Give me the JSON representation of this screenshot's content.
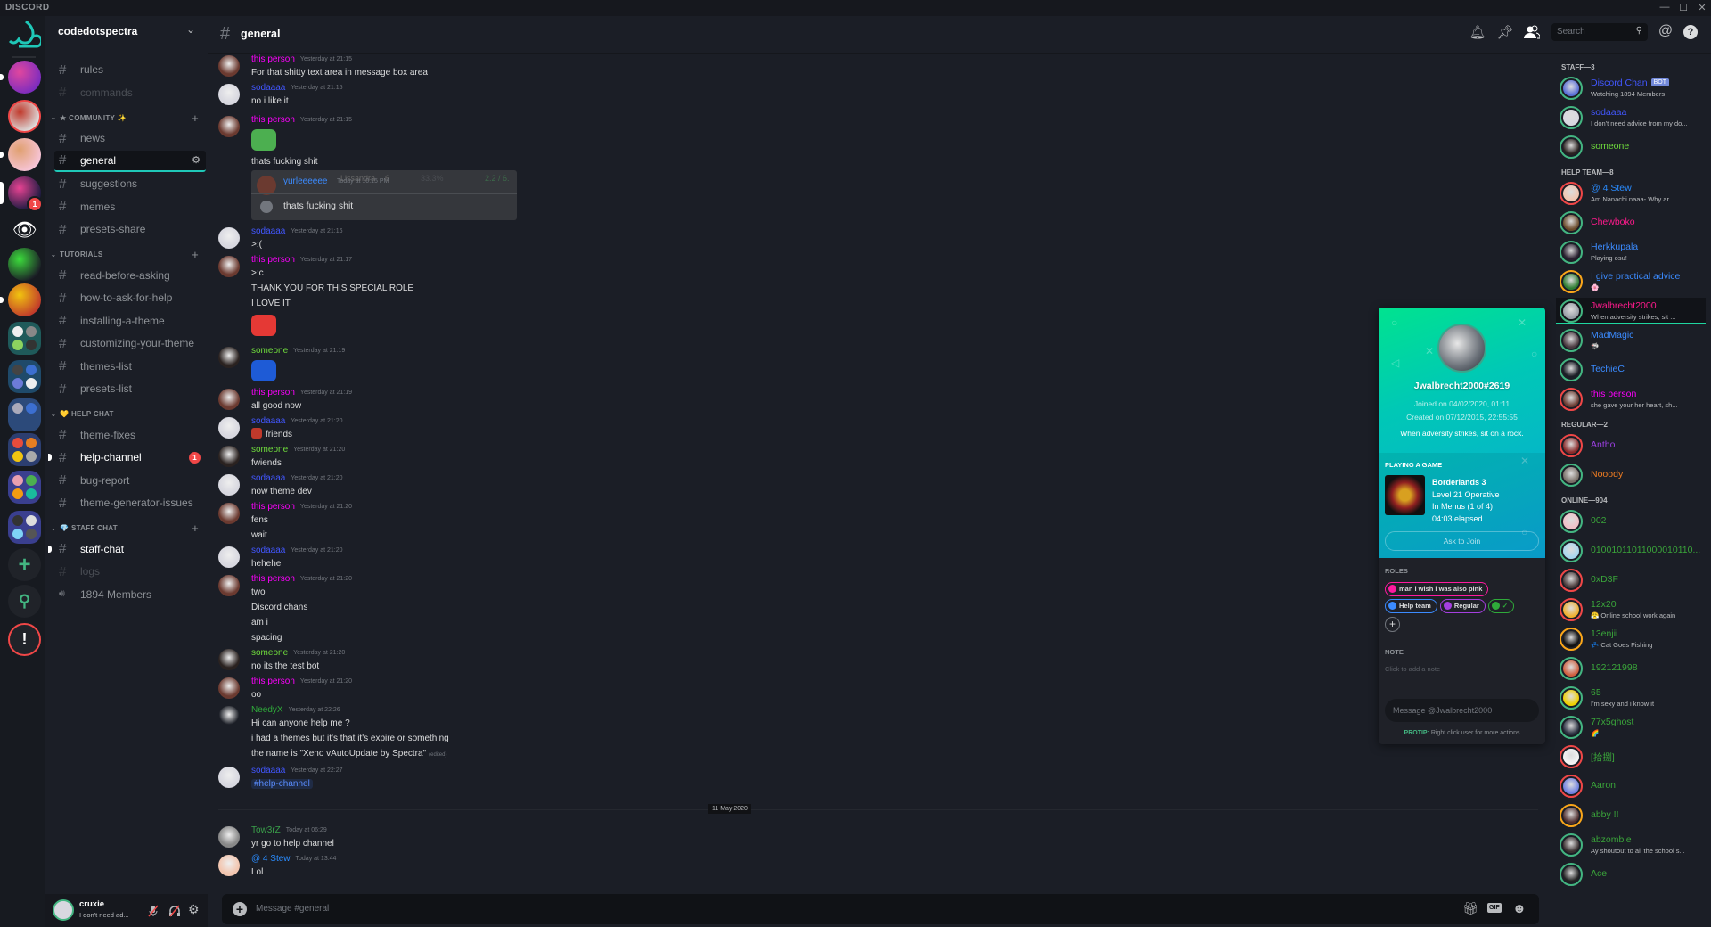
{
  "window": {
    "brand": "DISCORD",
    "min": "—",
    "max": "☐",
    "close": "✕"
  },
  "colors": {
    "accent": "#1fc8b8",
    "online": "#43b581",
    "idle": "#faa61a",
    "dnd": "#f04747"
  },
  "servers": [
    {
      "type": "logo",
      "icon": "spectra-logo-icon"
    },
    {
      "type": "icon",
      "colors": [
        "#7b2cbf",
        "#e0479e"
      ],
      "pill": "dot"
    },
    {
      "type": "icon",
      "colors": [
        "#ddd",
        "#c0392b"
      ],
      "ring": "#f04747"
    },
    {
      "type": "icon",
      "colors": [
        "#f7c5d8",
        "#e0a070"
      ],
      "pill": "dot"
    },
    {
      "type": "icon",
      "colors": [
        "#1a1a40",
        "#e84393"
      ],
      "pill": "active",
      "badge": "1"
    },
    {
      "type": "eye",
      "icon": "eye-icon"
    },
    {
      "type": "icon",
      "colors": [
        "#1b1e26",
        "#3cdc3c"
      ]
    },
    {
      "type": "icon",
      "colors": [
        "#c0392b",
        "#f1c40f"
      ],
      "pill": "dot"
    },
    {
      "type": "folder",
      "bg": "#1f5a5a",
      "dots": [
        "#eee",
        "#888",
        "#8dd35f",
        "#333"
      ]
    },
    {
      "type": "folder",
      "bg": "#1f4a6a",
      "dots": [
        "#444",
        "#3c6fd0",
        "#6c7bd8",
        "#eee"
      ]
    },
    {
      "type": "folder",
      "bg": "#2c4a7a",
      "dots": [
        "#aab",
        "#3c6fd0",
        "#2c4a7a",
        "#2c4a7a"
      ]
    },
    {
      "type": "folder",
      "bg": "#2c3e70",
      "dots": [
        "#e74c3c",
        "#e67e22",
        "#f1c40f",
        "#aaa"
      ]
    },
    {
      "type": "folder",
      "bg": "#3a3f8f",
      "dots": [
        "#e9a0b0",
        "#4caf50",
        "#f39c12",
        "#1abc9c"
      ]
    },
    {
      "type": "folder",
      "bg": "#3a3f8f",
      "dots": [
        "#333",
        "#ddd",
        "#7fd3f7",
        "#555"
      ]
    },
    {
      "type": "add",
      "icon": "plus-icon",
      "glyph": "+"
    },
    {
      "type": "search",
      "icon": "search-icon",
      "glyph": "⚲"
    },
    {
      "type": "alert",
      "icon": "alert-icon",
      "glyph": "!"
    }
  ],
  "guild": {
    "name": "codedotspectra",
    "chevron": "⌄"
  },
  "channels": [
    {
      "kind": "ch",
      "name": "rules"
    },
    {
      "kind": "ch",
      "name": "commands",
      "state": "muted"
    },
    {
      "kind": "cat",
      "name": "★ COMMUNITY ✨",
      "plus": "+"
    },
    {
      "kind": "ch",
      "name": "news"
    },
    {
      "kind": "ch",
      "name": "general",
      "state": "sel",
      "gear": "⚙"
    },
    {
      "kind": "ch",
      "name": "suggestions"
    },
    {
      "kind": "ch",
      "name": "memes"
    },
    {
      "kind": "ch",
      "name": "presets-share"
    },
    {
      "kind": "cat",
      "name": "TUTORIALS",
      "plus": "+"
    },
    {
      "kind": "ch",
      "name": "read-before-asking"
    },
    {
      "kind": "ch",
      "name": "how-to-ask-for-help"
    },
    {
      "kind": "ch",
      "name": "installing-a-theme"
    },
    {
      "kind": "ch",
      "name": "customizing-your-theme"
    },
    {
      "kind": "ch",
      "name": "themes-list"
    },
    {
      "kind": "ch",
      "name": "presets-list"
    },
    {
      "kind": "cat",
      "name": "💛 HELP CHAT"
    },
    {
      "kind": "ch",
      "name": "theme-fixes"
    },
    {
      "kind": "ch",
      "name": "help-channel",
      "state": "unread",
      "badge": "1"
    },
    {
      "kind": "ch",
      "name": "bug-report"
    },
    {
      "kind": "ch",
      "name": "theme-generator-issues"
    },
    {
      "kind": "cat",
      "name": "💎 STAFF CHAT",
      "plus": "+"
    },
    {
      "kind": "ch",
      "name": "staff-chat",
      "state": "unread"
    },
    {
      "kind": "ch",
      "name": "logs",
      "state": "muted"
    },
    {
      "kind": "voice",
      "name": "1894 Members"
    }
  ],
  "user": {
    "name": "cruxie",
    "status": "I don't need ad...",
    "mute_icon": "microphone-muted-icon",
    "deafen_icon": "headphones-muted-icon",
    "settings_icon": "gear-icon"
  },
  "header": {
    "channel": "general",
    "search_placeholder": "Search"
  },
  "messages": [
    {
      "author": "this person",
      "color": "#ff00ff",
      "avatar": "#6b3a30",
      "time": "Yesterday at 21:15",
      "lines": [
        {
          "t": "text",
          "v": "For that shitty text area in message box area"
        }
      ]
    },
    {
      "author": "sodaaaa",
      "color": "#4257ff",
      "avatar": "#d8d8e0",
      "time": "Yesterday at 21:15",
      "lines": [
        {
          "t": "text",
          "v": "no i like it"
        }
      ]
    },
    {
      "author": "this person",
      "color": "#ff00ff",
      "avatar": "#6b3a30",
      "time": "Yesterday at 21:15",
      "lines": [
        {
          "t": "emoji",
          "name": "pepe-emoji",
          "c": "#4caf50"
        },
        {
          "t": "text",
          "v": "thats fucking shit"
        },
        {
          "t": "embed",
          "author": "yurleeeeee",
          "time": "Today at 10:15 PM",
          "text": "thats fucking shit",
          "bg1": "Lissandra",
          "bg2": "6",
          "bg3": "33.3%",
          "bg4": "2.2 / 6."
        }
      ]
    },
    {
      "author": "sodaaaa",
      "color": "#4257ff",
      "avatar": "#d8d8e0",
      "time": "Yesterday at 21:16",
      "lines": [
        {
          "t": "text",
          "v": ">:("
        }
      ]
    },
    {
      "author": "this person",
      "color": "#ff00ff",
      "avatar": "#6b3a30",
      "time": "Yesterday at 21:17",
      "lines": [
        {
          "t": "text",
          "v": ">:c"
        },
        {
          "t": "text",
          "v": "THANK YOU FOR THIS SPECIAL ROLE"
        },
        {
          "t": "text",
          "v": "I LOVE IT"
        },
        {
          "t": "emoji",
          "name": "heart-emoji",
          "c": "#e53935"
        }
      ]
    },
    {
      "author": "someone",
      "color": "#6fdc3c",
      "avatar": "#2a2220",
      "time": "Yesterday at 21:19",
      "lines": [
        {
          "t": "emoji",
          "name": "blue-blob-emoji",
          "c": "#1e5bd6"
        }
      ]
    },
    {
      "author": "this person",
      "color": "#ff00ff",
      "avatar": "#6b3a30",
      "time": "Yesterday at 21:19",
      "lines": [
        {
          "t": "text",
          "v": "all good now"
        }
      ]
    },
    {
      "author": "sodaaaa",
      "color": "#4257ff",
      "avatar": "#d8d8e0",
      "time": "Yesterday at 21:20",
      "lines": [
        {
          "t": "text",
          "v": "friends",
          "emoji": true
        }
      ]
    },
    {
      "author": "someone",
      "color": "#6fdc3c",
      "avatar": "#2a2220",
      "time": "Yesterday at 21:20",
      "lines": [
        {
          "t": "text",
          "v": "fwiends"
        }
      ]
    },
    {
      "author": "sodaaaa",
      "color": "#4257ff",
      "avatar": "#d8d8e0",
      "time": "Yesterday at 21:20",
      "lines": [
        {
          "t": "text",
          "v": "now theme dev"
        }
      ]
    },
    {
      "author": "this person",
      "color": "#ff00ff",
      "avatar": "#6b3a30",
      "time": "Yesterday at 21:20",
      "lines": [
        {
          "t": "text",
          "v": "fens"
        },
        {
          "t": "text",
          "v": "wait"
        }
      ]
    },
    {
      "author": "sodaaaa",
      "color": "#4257ff",
      "avatar": "#d8d8e0",
      "time": "Yesterday at 21:20",
      "lines": [
        {
          "t": "text",
          "v": "hehehe"
        }
      ]
    },
    {
      "author": "this person",
      "color": "#ff00ff",
      "avatar": "#6b3a30",
      "time": "Yesterday at 21:20",
      "lines": [
        {
          "t": "text",
          "v": "two"
        },
        {
          "t": "text",
          "v": "Discord chans"
        },
        {
          "t": "text",
          "v": "am i"
        },
        {
          "t": "text",
          "v": "spacing"
        }
      ]
    },
    {
      "author": "someone",
      "color": "#6fdc3c",
      "avatar": "#2a2220",
      "time": "Yesterday at 21:20",
      "lines": [
        {
          "t": "text",
          "v": "no its the test bot"
        }
      ]
    },
    {
      "author": "this person",
      "color": "#ff00ff",
      "avatar": "#6b3a30",
      "time": "Yesterday at 21:20",
      "lines": [
        {
          "t": "text",
          "v": "oo"
        }
      ]
    },
    {
      "author": "NeedyX",
      "color": "#2faa3a",
      "avatar": "#1b1e26",
      "time": "Yesterday at 22:26",
      "lines": [
        {
          "t": "text",
          "v": "Hi can anyone help me ?"
        },
        {
          "t": "text",
          "v": "i had a themes but it's that it's expire or something"
        },
        {
          "t": "text",
          "v": "the name is \"Xeno vAutoUpdate by Spectra\"",
          "edited": "(edited)"
        }
      ]
    },
    {
      "author": "sodaaaa",
      "color": "#4257ff",
      "avatar": "#d8d8e0",
      "time": "Yesterday at 22:27",
      "lines": [
        {
          "t": "mention",
          "v": "#help-channel"
        }
      ]
    },
    {
      "divider": "11 May 2020"
    },
    {
      "author": "Tow3rZ",
      "color": "#3aa04a",
      "avatar": "#888",
      "time": "Today at 06:29",
      "lines": [
        {
          "t": "text",
          "v": "yr go to help channel"
        }
      ]
    },
    {
      "author": "@ 4 Stew",
      "color": "#2a8cff",
      "avatar": "#f2c6b0",
      "time": "Today at 13:44",
      "lines": [
        {
          "t": "text",
          "v": "Lol"
        }
      ]
    }
  ],
  "composer": {
    "placeholder": "Message #general",
    "icons": [
      "gift-icon",
      "gif-icon",
      "emoji-icon"
    ],
    "gif": "GIF"
  },
  "members": [
    {
      "section": "STAFF—3"
    },
    {
      "name": "Discord Chan",
      "color": "#4257ff",
      "bot": "BOT",
      "activity": "Watching 1894 Members",
      "status": "online",
      "av": "#5a6fd8"
    },
    {
      "name": "sodaaaa",
      "color": "#4257ff",
      "activity": "I don't need advice from my do...",
      "status": "online",
      "av": "#d8d8e0"
    },
    {
      "name": "someone",
      "color": "#6fdc3c",
      "status": "online",
      "av": "#2a2220"
    },
    {
      "section": "HELP TEAM—8"
    },
    {
      "name": "@ 4 Stew",
      "color": "#2a8cff",
      "activity": "Am Nanachi naaa- Why ar...",
      "status": "dnd",
      "av": "#f2c6b0"
    },
    {
      "name": "Chewboko",
      "color": "#ff1a8c",
      "status": "online",
      "av": "#6a4a2a"
    },
    {
      "name": "Herkkupala",
      "color": "#3b8bff",
      "activity": "Playing osu!",
      "status": "online",
      "av": "#2a2030"
    },
    {
      "name": "I give practical advice",
      "color": "#3b8bff",
      "activity": "🌸",
      "status": "idle",
      "av": "#2e7d32"
    },
    {
      "name": "Jwalbrecht2000",
      "color": "#ff1a8c",
      "activity": "When adversity strikes, sit ...",
      "status": "online",
      "av": "#9aa0a8",
      "selected": true
    },
    {
      "name": "MadMagic",
      "color": "#3b8bff",
      "activity": "🦈",
      "status": "online",
      "av": "#4a3a40"
    },
    {
      "name": "TechieC",
      "color": "#3b8bff",
      "status": "online",
      "av": "#1b1e26"
    },
    {
      "name": "this person",
      "color": "#ff00ff",
      "activity": "she gave your her heart, sh...",
      "status": "dnd",
      "av": "#6b3a30"
    },
    {
      "section": "REGULAR—2"
    },
    {
      "name": "Antho",
      "color": "#9b3fe0",
      "status": "dnd",
      "av": "#8b2a2a"
    },
    {
      "name": "Nooody",
      "color": "#f07d22",
      "status": "online",
      "av": "#7a7068"
    },
    {
      "section": "ONLINE—904"
    },
    {
      "name": "002",
      "color": "#3aa53a",
      "status": "online",
      "av": "#f0c0c8"
    },
    {
      "name": "01001011011000010110...",
      "color": "#3aa53a",
      "status": "online",
      "av": "#a8d8f0"
    },
    {
      "name": "0xD3F",
      "color": "#3aa53a",
      "status": "dnd",
      "av": "#4a3a3a"
    },
    {
      "name": "12x20",
      "color": "#3aa53a",
      "activity": "😤 Online school work again",
      "status": "dnd",
      "av": "#f0b030"
    },
    {
      "name": "13enjii",
      "color": "#3aa53a",
      "activity": "💤 Cat Goes Fishing",
      "status": "idle",
      "av": "#111"
    },
    {
      "name": "192121998",
      "color": "#3aa53a",
      "status": "online",
      "av": "#d06040"
    },
    {
      "name": "65",
      "color": "#3aa53a",
      "activity": "I'm sexy and i know it",
      "status": "online",
      "av": "#f0d000"
    },
    {
      "name": "77x5ghost",
      "color": "#3aa53a",
      "activity": "🌈",
      "status": "online",
      "av": "#2a3040"
    },
    {
      "name": "[拾捌]",
      "color": "#3aa53a",
      "status": "dnd",
      "av": "#f4f4f4"
    },
    {
      "name": "Aaron",
      "color": "#3aa53a",
      "status": "dnd",
      "av": "#7080e0"
    },
    {
      "name": "abby !!",
      "color": "#3aa53a",
      "status": "idle",
      "av": "#503030"
    },
    {
      "name": "abzombie",
      "color": "#3aa53a",
      "activity": "Ay shoutout to all the school s...",
      "status": "online",
      "av": "#3a3030"
    },
    {
      "name": "Ace",
      "color": "#3aa53a",
      "status": "online",
      "av": "#222"
    }
  ],
  "popup": {
    "username": "Jwalbrecht2000#2619",
    "joined": "Joined on 04/02/2020, 01:11",
    "created": "Created on 07/12/2015, 22:55:55",
    "bio": "When adversity strikes, sit on a rock.",
    "activity_label": "PLAYING A GAME",
    "game": {
      "title": "Borderlands 3",
      "details": "Level 21 Operative",
      "state": "In Menus (1 of 4)",
      "elapsed": "04:03 elapsed"
    },
    "ask_to_join": "Ask to Join",
    "roles_label": "ROLES",
    "roles": [
      {
        "name": "man i wish i was also pink",
        "color": "#ff1aa0"
      },
      {
        "name": "Help team",
        "color": "#3b8bff"
      },
      {
        "name": "Regular",
        "color": "#a53fe0"
      },
      {
        "name": "✓",
        "color": "#2faa3a"
      }
    ],
    "add_role": "+",
    "note_label": "NOTE",
    "note_placeholder": "Click to add a note",
    "message_placeholder": "Message @Jwalbrecht2000",
    "protip_label": "PROTIP:",
    "protip_text": "Right click user for more actions"
  }
}
